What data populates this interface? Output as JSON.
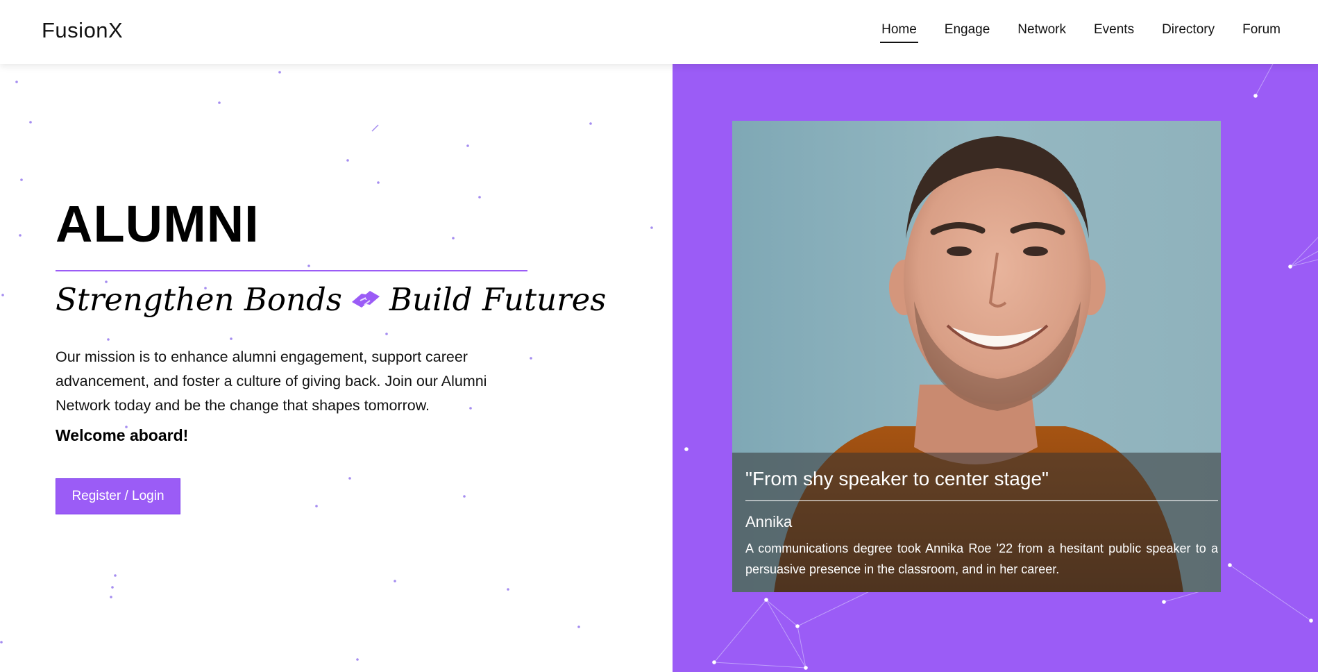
{
  "header": {
    "brand": "FusionX",
    "nav": [
      {
        "label": "Home",
        "active": true
      },
      {
        "label": "Engage",
        "active": false
      },
      {
        "label": "Network",
        "active": false
      },
      {
        "label": "Events",
        "active": false
      },
      {
        "label": "Directory",
        "active": false
      },
      {
        "label": "Forum",
        "active": false
      }
    ]
  },
  "hero": {
    "title": "ALUMNI",
    "tagline_left": "Strengthen Bonds",
    "tagline_icon": "handshake-icon",
    "tagline_right": "Build Futures",
    "mission": "Our mission is to enhance alumni engagement, support career advancement, and foster a culture of giving back. Join our Alumni Network today and be the change that shapes tomorrow.",
    "welcome": "Welcome aboard!",
    "cta_label": "Register / Login"
  },
  "story": {
    "quote": "\"From shy speaker to center stage\"",
    "name": "Annika",
    "text": "A communications degree took Annika Roe '22 from a hesitant public speaker to a persuasive presence in the classroom, and in her career."
  },
  "colors": {
    "accent": "#9b5cf6",
    "header_bg": "#ffffff",
    "caption_overlay": "rgba(52,52,52,0.55)"
  }
}
